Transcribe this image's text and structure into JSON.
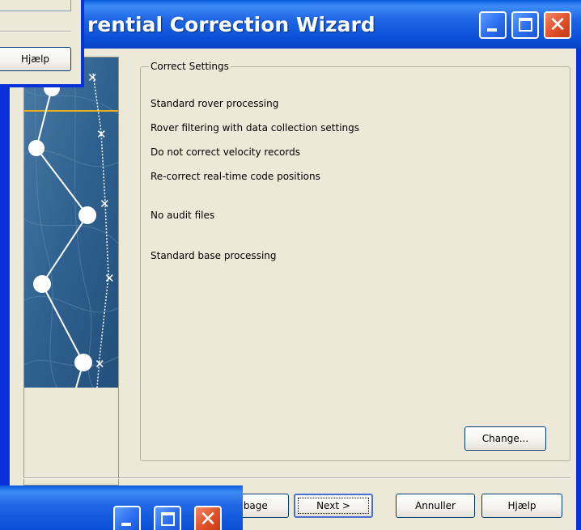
{
  "window": {
    "title": "rential Correction Wizard",
    "title_bar_color": "#0a54e0"
  },
  "group": {
    "legend": "Correct Settings",
    "settings": [
      "Standard rover processing",
      "Rover filtering with data collection settings",
      "Do not correct velocity records",
      "Re-correct real-time code positions",
      "No audit files",
      "Standard base processing"
    ],
    "change_label": "Change..."
  },
  "footer": {
    "back_label": "Tilbage",
    "next_label": "Next  >",
    "cancel_label": "Annuller",
    "help_label": "Hjælp"
  },
  "overlay_dialog": {
    "help_label": "Hjælp"
  },
  "icons": {
    "minimize": "minimize-icon",
    "maximize": "maximize-icon",
    "close": "close-icon",
    "wizard_art": "gps-track-map-art"
  }
}
